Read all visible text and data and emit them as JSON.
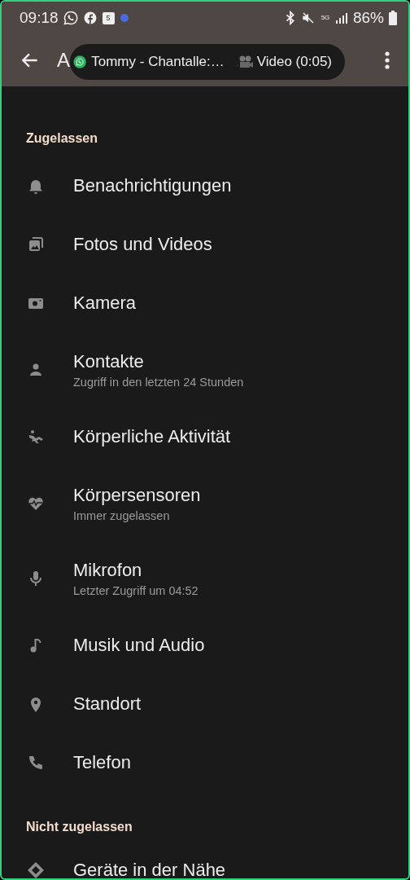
{
  "status_bar": {
    "time": "09:18",
    "calendar_day": "5",
    "network": "5G",
    "battery": "86%"
  },
  "toolbar": {
    "title": "A"
  },
  "call_pill": {
    "name": "Tommy - Chantalle:…",
    "label": "Video (0:05)"
  },
  "sections": [
    {
      "header": "Zugelassen",
      "items": [
        {
          "title": "Benachrichtigungen"
        },
        {
          "title": "Fotos und Videos"
        },
        {
          "title": "Kamera"
        },
        {
          "title": "Kontakte",
          "subtitle": "Zugriff in den letzten 24 Stunden"
        },
        {
          "title": "Körperliche Aktivität"
        },
        {
          "title": "Körpersensoren",
          "subtitle": "Immer zugelassen"
        },
        {
          "title": "Mikrofon",
          "subtitle": "Letzter Zugriff um 04:52"
        },
        {
          "title": "Musik und Audio"
        },
        {
          "title": "Standort"
        },
        {
          "title": "Telefon"
        }
      ]
    },
    {
      "header": "Nicht zugelassen",
      "items": [
        {
          "title": "Geräte in der Nähe"
        }
      ]
    }
  ]
}
